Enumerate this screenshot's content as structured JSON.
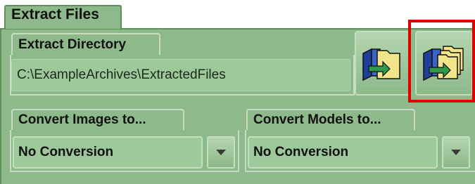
{
  "outer_tab": {
    "label": "Extract Files"
  },
  "extract_directory": {
    "label": "Extract Directory",
    "path": "C:\\ExampleArchives\\ExtractedFiles",
    "buttons": [
      {
        "icon": "extract-folder-icon"
      },
      {
        "icon": "extract-all-folders-icon"
      }
    ]
  },
  "convert_images": {
    "label": "Convert Images to...",
    "selected": "No Conversion"
  },
  "convert_models": {
    "label": "Convert Models to...",
    "selected": "No Conversion"
  },
  "colors": {
    "panel": "#8eb98a",
    "highlight": "#e00000",
    "folder": "#f2e48a",
    "arrow": "#2f9a4a",
    "blue": "#1f3f9a"
  }
}
